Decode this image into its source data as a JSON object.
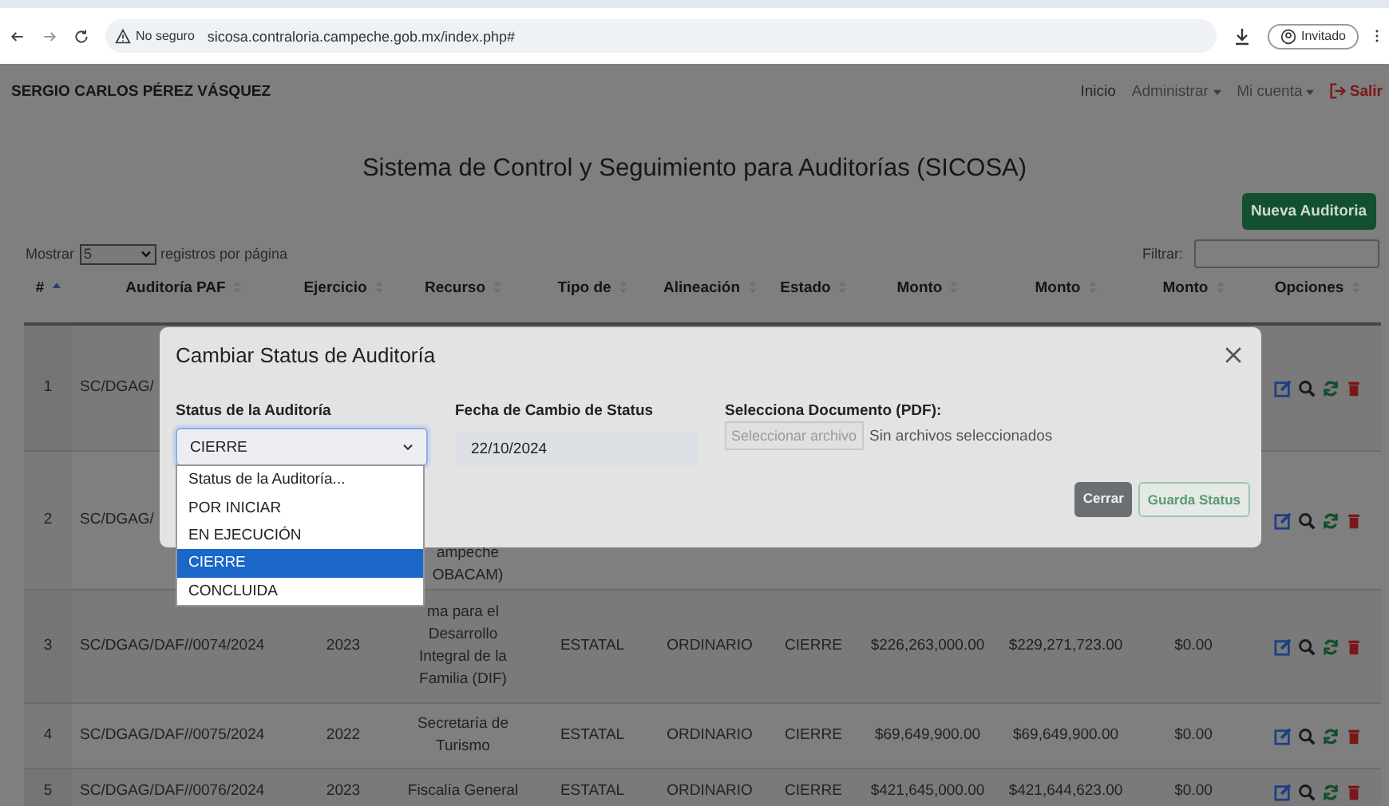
{
  "browser": {
    "security_label": "No seguro",
    "url": "sicosa.contraloria.campeche.gob.mx/index.php#",
    "profile": "Invitado"
  },
  "navbar": {
    "user": "SERGIO CARLOS PÉREZ VÁSQUEZ",
    "links": [
      {
        "label": "Inicio",
        "kind": "link"
      },
      {
        "label": "Administrar",
        "kind": "dropdown"
      },
      {
        "label": "Mi cuenta",
        "kind": "dropdown"
      },
      {
        "label": "Salir",
        "kind": "logout"
      }
    ]
  },
  "page": {
    "title": "Sistema de Control y Seguimiento para Auditorías (SICOSA)",
    "new_button": "Nueva Auditoria"
  },
  "table_controls": {
    "show_label": "Mostrar",
    "page_size": "5",
    "per_page_label": "registros por página",
    "filter_label": "Filtrar:"
  },
  "table": {
    "columns": [
      {
        "label": "#",
        "sorted": true
      },
      {
        "label": "Auditoría PAF",
        "sorted": false
      },
      {
        "label": "Ejercicio",
        "sorted": false
      },
      {
        "label": "Recurso",
        "sorted": false
      },
      {
        "label": "Tipo de",
        "sorted": false
      },
      {
        "label": "Alineación",
        "sorted": false
      },
      {
        "label": "Estado",
        "sorted": false
      },
      {
        "label": "Monto",
        "sorted": false
      },
      {
        "label": "Monto",
        "sorted": false
      },
      {
        "label": "Monto",
        "sorted": false
      },
      {
        "label": "Opciones",
        "sorted": false
      }
    ],
    "rows": [
      {
        "number": "1",
        "audit": "SC/DGAG/"
      },
      {
        "number": "2",
        "audit": "SC/DGAG/",
        "resource": "ampeche\nOBACAM)"
      },
      {
        "number": "3",
        "audit": "SC/DGAG/DAF//0074/2024",
        "year": "2023",
        "resource": "ma para el\nDesarrollo\nIntegral de la\nFamilia (DIF)",
        "type": "ESTATAL",
        "alignment": "ORDINARIO",
        "state": "CIERRE",
        "exercised": "$226,263,000.00",
        "reviewed": "$229,271,723.00",
        "observed": "$0.00"
      },
      {
        "number": "4",
        "audit": "SC/DGAG/DAF//0075/2024",
        "year": "2022",
        "resource": "Secretaría de\nTurismo",
        "type": "ESTATAL",
        "alignment": "ORDINARIO",
        "state": "CIERRE",
        "exercised": "$69,649,900.00",
        "reviewed": "$69,649,900.00",
        "observed": "$0.00"
      },
      {
        "number": "5",
        "audit": "SC/DGAG/DAF//0076/2024",
        "year": "2023",
        "resource": "Fiscalía General",
        "type": "ESTATAL",
        "alignment": "ORDINARIO",
        "state": "CIERRE",
        "exercised": "$421,645,000.00",
        "reviewed": "$421,644,623.00",
        "observed": "$0.00"
      }
    ]
  },
  "modal": {
    "title": "Cambiar Status de Auditoría",
    "fields": [
      {
        "kind": "select",
        "label": "Status de la Auditoría",
        "value": "CIERRE",
        "expanded": true,
        "options": [
          {
            "label": "Status de la Auditoría...",
            "selected": false
          },
          {
            "label": "POR INICIAR",
            "selected": false
          },
          {
            "label": "EN EJECUCIÓN",
            "selected": false
          },
          {
            "label": "CIERRE",
            "selected": true
          },
          {
            "label": "CONCLUIDA",
            "selected": false
          }
        ]
      },
      {
        "kind": "date",
        "label": "Fecha de Cambio de Status",
        "value": "22/10/2024"
      },
      {
        "kind": "file",
        "label": "Selecciona Documento (PDF):",
        "button": "Seleccionar archivo",
        "status": "Sin archivos seleccionados"
      }
    ],
    "buttons": [
      {
        "label": "Cerrar",
        "kind": "secondary"
      },
      {
        "label": "Guarda Status",
        "kind": "outline-success"
      }
    ]
  }
}
